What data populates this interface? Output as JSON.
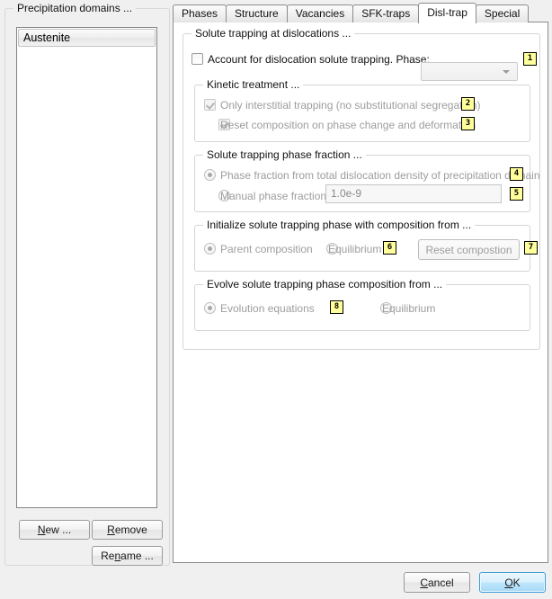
{
  "left_panel": {
    "title": "Precipitation domains ...",
    "list_items": [
      {
        "label": "Austenite",
        "selected": true
      }
    ],
    "buttons": {
      "new": {
        "pre": "",
        "mnemonic": "N",
        "post": "ew ..."
      },
      "remove": {
        "pre": "",
        "mnemonic": "R",
        "post": "emove"
      },
      "rename": {
        "pre": "Re",
        "mnemonic": "n",
        "post": "ame ..."
      }
    }
  },
  "tabs": [
    {
      "label": "Phases",
      "active": false
    },
    {
      "label": "Structure",
      "active": false
    },
    {
      "label": "Vacancies",
      "active": false
    },
    {
      "label": "SFK-traps",
      "active": false
    },
    {
      "label": "Disl-trap",
      "active": true
    },
    {
      "label": "Special",
      "active": false
    }
  ],
  "solute_group": {
    "title": "Solute trapping at dislocations ...",
    "account_checkbox": {
      "label": "Account for dislocation solute trapping. Phase:",
      "checked": false,
      "enabled": true
    },
    "phase_combo": {
      "value": "",
      "enabled": false
    },
    "badge_1": "1"
  },
  "kinetic_group": {
    "title": "Kinetic treatment ...",
    "items": [
      {
        "label": "Only interstitial trapping (no substitutional segregation)",
        "checked": true,
        "enabled": false,
        "badge": "2"
      },
      {
        "label": "Reset composition on phase change and deformation",
        "checked": true,
        "enabled": false,
        "badge": "3"
      }
    ]
  },
  "fraction_group": {
    "title": "Solute trapping phase fraction ...",
    "option_total": {
      "label": "Phase fraction from total dislocation density of precipitation domain",
      "selected": true,
      "enabled": false,
      "badge": "4"
    },
    "option_manual": {
      "label": "Manual phase fraction",
      "selected": false,
      "enabled": false,
      "badge": "5"
    },
    "manual_value": "1.0e-9"
  },
  "init_group": {
    "title": "Initialize solute trapping phase with composition from ...",
    "option_parent": {
      "label": "Parent composition",
      "selected": true,
      "enabled": false
    },
    "option_equilibrium": {
      "label": "Equilibrium",
      "selected": false,
      "enabled": false,
      "badge": "6"
    },
    "reset_button": {
      "label": "Reset compostion",
      "enabled": false,
      "badge": "7"
    }
  },
  "evolve_group": {
    "title": "Evolve solute trapping phase composition from ...",
    "option_equations": {
      "label": "Evolution equations",
      "selected": true,
      "enabled": false,
      "badge": "8"
    },
    "option_equilibrium": {
      "label": "Equilibrium",
      "selected": false,
      "enabled": false
    }
  },
  "dialog_buttons": {
    "cancel": {
      "pre": "",
      "mnemonic": "C",
      "post": "ancel"
    },
    "ok": {
      "pre": "",
      "mnemonic": "O",
      "post": "K"
    }
  },
  "colors": {
    "badge_bg": "#ffff9c",
    "ok_accent": "#3c9cd4",
    "window_bg": "#f0f0f0",
    "panel_bg": "#ffffff"
  }
}
